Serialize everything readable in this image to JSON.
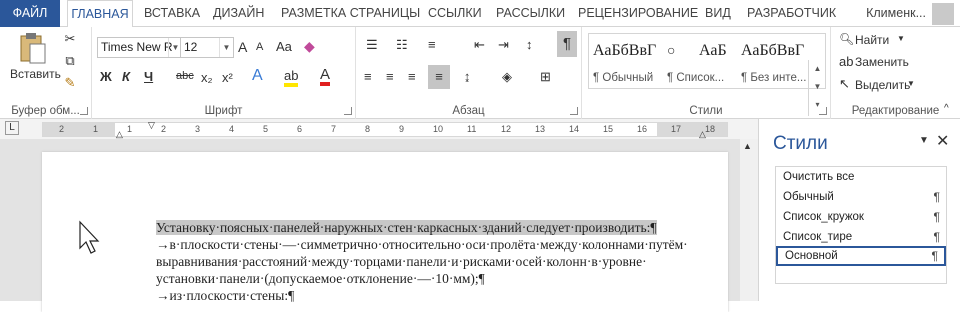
{
  "tabs": {
    "file": "ФАЙЛ",
    "home": "ГЛАВНАЯ",
    "insert": "ВСТАВКА",
    "design": "ДИЗАЙН",
    "layout": "РАЗМЕТКА СТРАНИЦЫ",
    "refs": "ССЫЛКИ",
    "mailings": "РАССЫЛКИ",
    "review": "РЕЦЕНЗИРОВАНИЕ",
    "view": "ВИД",
    "developer": "РАЗРАБОТЧИК"
  },
  "user": {
    "name": "Клименк..."
  },
  "clipboard": {
    "paste": "Вставить",
    "label": "Буфер обм..."
  },
  "font": {
    "name": "Times New R",
    "size": "12",
    "label": "Шрифт",
    "bold": "Ж",
    "italic": "К",
    "underline": "Ч",
    "strike": "abc",
    "sub": "x₂",
    "sup": "x²",
    "grow": "A",
    "shrink": "A",
    "case": "Aa",
    "effects": "A",
    "highlight": "ab",
    "color": "A"
  },
  "paragraph": {
    "label": "Абзац",
    "pilcrow": "¶"
  },
  "styles": {
    "label": "Стили",
    "cells": [
      {
        "sample": "АаБбВвГ",
        "name": "¶ Обычный"
      },
      {
        "sample": "АаБ",
        "name": "¶ Список..."
      },
      {
        "sample": "АаБбВвГ",
        "name": "¶ Без инте..."
      }
    ],
    "bullet_sample": "○"
  },
  "editing": {
    "find": "Найти",
    "replace": "Заменить",
    "select": "Выделить",
    "label": "Редактирование"
  },
  "ruler": {
    "numbers": [
      "2",
      "1",
      "1",
      "2",
      "3",
      "4",
      "5",
      "6",
      "7",
      "8",
      "9",
      "10",
      "11",
      "12",
      "13",
      "14",
      "15",
      "16",
      "17",
      "18"
    ]
  },
  "doc": {
    "lines": [
      "Установку·поясных·панелей·наружных·стен·каркасных·зданий·следует·производить:¶",
      "→в·плоскости·стены·—·симметрично·относительно·оси·пролёта·между·колоннами·путём·",
      "   выравнивания·расстояний·между·торцами·панели·и·рисками·осей·колонн·в·уровне·",
      "   установки·панели·(допускаемое·отклонение·—·10·мм);¶",
      "→из·плоскости·стены:¶"
    ]
  },
  "pane": {
    "title": "Стили",
    "items": [
      "Очистить все",
      "Обычный",
      "Список_кружок",
      "Список_тире",
      "Основной"
    ],
    "pilcrow": "¶",
    "selected": 4
  }
}
